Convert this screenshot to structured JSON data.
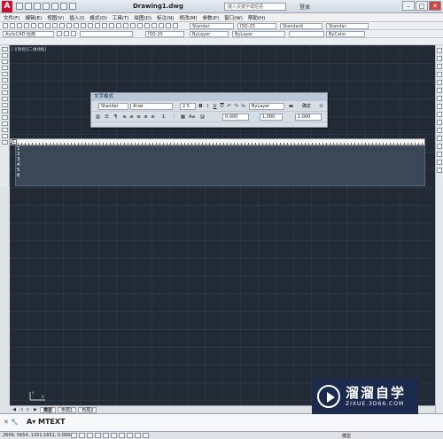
{
  "app": {
    "logo": "A",
    "doc_title": "Drawing1.dwg",
    "search_placeholder": "键入关键字或短语",
    "login": "登录"
  },
  "menu": [
    "文件(F)",
    "编辑(E)",
    "视图(V)",
    "插入(I)",
    "格式(O)",
    "工具(T)",
    "绘图(D)",
    "标注(N)",
    "修改(M)",
    "参数(P)",
    "窗口(W)",
    "帮助(H)"
  ],
  "toolbar2": {
    "fields": [
      "Standar",
      "ISO-25",
      "Standard",
      "Standar"
    ]
  },
  "toolbar3": {
    "workspace": "AutoCAD 经典",
    "layer_dim": "ISO-25",
    "props": [
      "ByLayer",
      "ByLayer",
      "ByColor"
    ]
  },
  "viewport": {
    "label": "[-][俯视][二维线框]"
  },
  "text_format": {
    "title": "文字格式",
    "style": "Standar",
    "font": "Arial",
    "height": "2.5",
    "bold": "B",
    "italic": "I",
    "underline": "U",
    "overline": "O",
    "color": "ByLayer",
    "ok": "确定",
    "oblique": "0.000",
    "tracking": "1.000",
    "width": "1.000"
  },
  "editor": {
    "lines": [
      "1",
      "2",
      "3",
      "4",
      "5",
      "6"
    ]
  },
  "layout_tabs": {
    "model": "模型",
    "layout1": "布局1",
    "layout2": "布局2"
  },
  "command": {
    "prompt": "MTEXT"
  },
  "status": {
    "coords": "2609, 5654, 1251.1651, 0.0000",
    "model": "模型"
  },
  "watermark": {
    "name": "溜溜自学",
    "url": "ZIXUE.3D66.COM"
  }
}
